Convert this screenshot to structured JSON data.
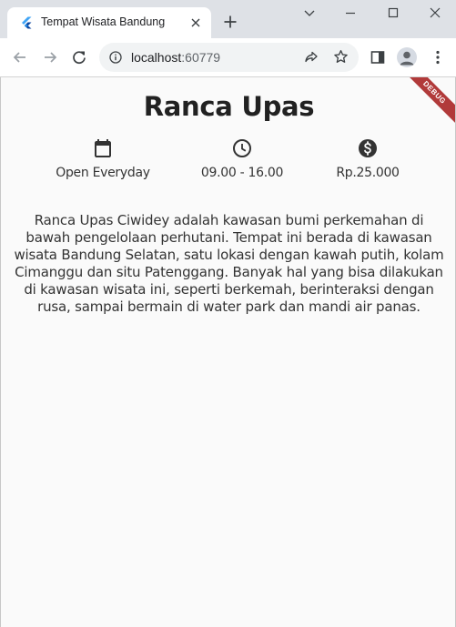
{
  "browser": {
    "tab": {
      "title": "Tempat Wisata Bandung",
      "favicon": "flutter-icon"
    },
    "window_controls": [
      "chevron-down-icon",
      "minimize-icon",
      "maximize-icon",
      "close-icon"
    ],
    "address_bar": {
      "host": "localhost",
      "port": ":60779"
    },
    "toolbar_icons": [
      "back-arrow-icon",
      "forward-arrow-icon",
      "reload-icon",
      "share-icon",
      "star-icon",
      "side-panel-icon",
      "profile-icon",
      "more-vert-icon"
    ]
  },
  "app": {
    "debug_banner": "DEBUG",
    "title": "Ranca Upas",
    "info": [
      {
        "icon": "calendar-icon",
        "text": "Open Everyday"
      },
      {
        "icon": "clock-icon",
        "text": "09.00 - 16.00"
      },
      {
        "icon": "money-icon",
        "text": "Rp.25.000"
      }
    ],
    "description": "Ranca Upas Ciwidey adalah kawasan bumi perkemahan di bawah pengelolaan perhutani. Tempat ini berada di kawasan wisata Bandung Selatan, satu lokasi dengan kawah putih, kolam Cimanggu dan situ Patenggang. Banyak hal yang bisa dilakukan di kawasan wisata ini, seperti berkemah, berinteraksi dengan rusa, sampai bermain di water park dan mandi air panas."
  }
}
